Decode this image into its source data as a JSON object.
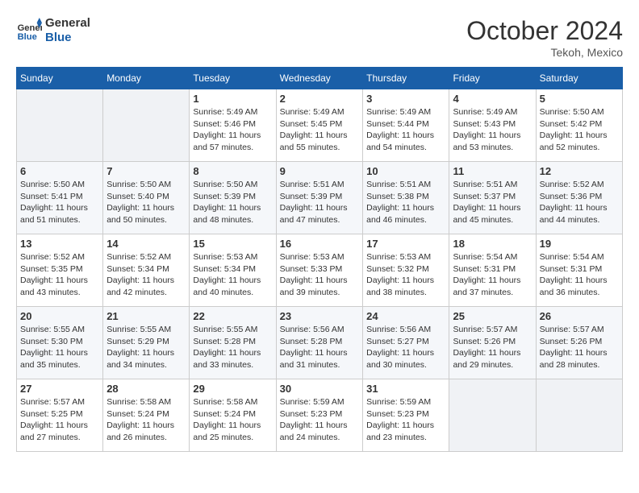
{
  "header": {
    "logo_general": "General",
    "logo_blue": "Blue",
    "month_title": "October 2024",
    "location": "Tekoh, Mexico"
  },
  "days_of_week": [
    "Sunday",
    "Monday",
    "Tuesday",
    "Wednesday",
    "Thursday",
    "Friday",
    "Saturday"
  ],
  "weeks": [
    [
      {
        "day": "",
        "sunrise": "",
        "sunset": "",
        "daylight": ""
      },
      {
        "day": "",
        "sunrise": "",
        "sunset": "",
        "daylight": ""
      },
      {
        "day": "1",
        "sunrise": "Sunrise: 5:49 AM",
        "sunset": "Sunset: 5:46 PM",
        "daylight": "Daylight: 11 hours and 57 minutes."
      },
      {
        "day": "2",
        "sunrise": "Sunrise: 5:49 AM",
        "sunset": "Sunset: 5:45 PM",
        "daylight": "Daylight: 11 hours and 55 minutes."
      },
      {
        "day": "3",
        "sunrise": "Sunrise: 5:49 AM",
        "sunset": "Sunset: 5:44 PM",
        "daylight": "Daylight: 11 hours and 54 minutes."
      },
      {
        "day": "4",
        "sunrise": "Sunrise: 5:49 AM",
        "sunset": "Sunset: 5:43 PM",
        "daylight": "Daylight: 11 hours and 53 minutes."
      },
      {
        "day": "5",
        "sunrise": "Sunrise: 5:50 AM",
        "sunset": "Sunset: 5:42 PM",
        "daylight": "Daylight: 11 hours and 52 minutes."
      }
    ],
    [
      {
        "day": "6",
        "sunrise": "Sunrise: 5:50 AM",
        "sunset": "Sunset: 5:41 PM",
        "daylight": "Daylight: 11 hours and 51 minutes."
      },
      {
        "day": "7",
        "sunrise": "Sunrise: 5:50 AM",
        "sunset": "Sunset: 5:40 PM",
        "daylight": "Daylight: 11 hours and 50 minutes."
      },
      {
        "day": "8",
        "sunrise": "Sunrise: 5:50 AM",
        "sunset": "Sunset: 5:39 PM",
        "daylight": "Daylight: 11 hours and 48 minutes."
      },
      {
        "day": "9",
        "sunrise": "Sunrise: 5:51 AM",
        "sunset": "Sunset: 5:39 PM",
        "daylight": "Daylight: 11 hours and 47 minutes."
      },
      {
        "day": "10",
        "sunrise": "Sunrise: 5:51 AM",
        "sunset": "Sunset: 5:38 PM",
        "daylight": "Daylight: 11 hours and 46 minutes."
      },
      {
        "day": "11",
        "sunrise": "Sunrise: 5:51 AM",
        "sunset": "Sunset: 5:37 PM",
        "daylight": "Daylight: 11 hours and 45 minutes."
      },
      {
        "day": "12",
        "sunrise": "Sunrise: 5:52 AM",
        "sunset": "Sunset: 5:36 PM",
        "daylight": "Daylight: 11 hours and 44 minutes."
      }
    ],
    [
      {
        "day": "13",
        "sunrise": "Sunrise: 5:52 AM",
        "sunset": "Sunset: 5:35 PM",
        "daylight": "Daylight: 11 hours and 43 minutes."
      },
      {
        "day": "14",
        "sunrise": "Sunrise: 5:52 AM",
        "sunset": "Sunset: 5:34 PM",
        "daylight": "Daylight: 11 hours and 42 minutes."
      },
      {
        "day": "15",
        "sunrise": "Sunrise: 5:53 AM",
        "sunset": "Sunset: 5:34 PM",
        "daylight": "Daylight: 11 hours and 40 minutes."
      },
      {
        "day": "16",
        "sunrise": "Sunrise: 5:53 AM",
        "sunset": "Sunset: 5:33 PM",
        "daylight": "Daylight: 11 hours and 39 minutes."
      },
      {
        "day": "17",
        "sunrise": "Sunrise: 5:53 AM",
        "sunset": "Sunset: 5:32 PM",
        "daylight": "Daylight: 11 hours and 38 minutes."
      },
      {
        "day": "18",
        "sunrise": "Sunrise: 5:54 AM",
        "sunset": "Sunset: 5:31 PM",
        "daylight": "Daylight: 11 hours and 37 minutes."
      },
      {
        "day": "19",
        "sunrise": "Sunrise: 5:54 AM",
        "sunset": "Sunset: 5:31 PM",
        "daylight": "Daylight: 11 hours and 36 minutes."
      }
    ],
    [
      {
        "day": "20",
        "sunrise": "Sunrise: 5:55 AM",
        "sunset": "Sunset: 5:30 PM",
        "daylight": "Daylight: 11 hours and 35 minutes."
      },
      {
        "day": "21",
        "sunrise": "Sunrise: 5:55 AM",
        "sunset": "Sunset: 5:29 PM",
        "daylight": "Daylight: 11 hours and 34 minutes."
      },
      {
        "day": "22",
        "sunrise": "Sunrise: 5:55 AM",
        "sunset": "Sunset: 5:28 PM",
        "daylight": "Daylight: 11 hours and 33 minutes."
      },
      {
        "day": "23",
        "sunrise": "Sunrise: 5:56 AM",
        "sunset": "Sunset: 5:28 PM",
        "daylight": "Daylight: 11 hours and 31 minutes."
      },
      {
        "day": "24",
        "sunrise": "Sunrise: 5:56 AM",
        "sunset": "Sunset: 5:27 PM",
        "daylight": "Daylight: 11 hours and 30 minutes."
      },
      {
        "day": "25",
        "sunrise": "Sunrise: 5:57 AM",
        "sunset": "Sunset: 5:26 PM",
        "daylight": "Daylight: 11 hours and 29 minutes."
      },
      {
        "day": "26",
        "sunrise": "Sunrise: 5:57 AM",
        "sunset": "Sunset: 5:26 PM",
        "daylight": "Daylight: 11 hours and 28 minutes."
      }
    ],
    [
      {
        "day": "27",
        "sunrise": "Sunrise: 5:57 AM",
        "sunset": "Sunset: 5:25 PM",
        "daylight": "Daylight: 11 hours and 27 minutes."
      },
      {
        "day": "28",
        "sunrise": "Sunrise: 5:58 AM",
        "sunset": "Sunset: 5:24 PM",
        "daylight": "Daylight: 11 hours and 26 minutes."
      },
      {
        "day": "29",
        "sunrise": "Sunrise: 5:58 AM",
        "sunset": "Sunset: 5:24 PM",
        "daylight": "Daylight: 11 hours and 25 minutes."
      },
      {
        "day": "30",
        "sunrise": "Sunrise: 5:59 AM",
        "sunset": "Sunset: 5:23 PM",
        "daylight": "Daylight: 11 hours and 24 minutes."
      },
      {
        "day": "31",
        "sunrise": "Sunrise: 5:59 AM",
        "sunset": "Sunset: 5:23 PM",
        "daylight": "Daylight: 11 hours and 23 minutes."
      },
      {
        "day": "",
        "sunrise": "",
        "sunset": "",
        "daylight": ""
      },
      {
        "day": "",
        "sunrise": "",
        "sunset": "",
        "daylight": ""
      }
    ]
  ]
}
